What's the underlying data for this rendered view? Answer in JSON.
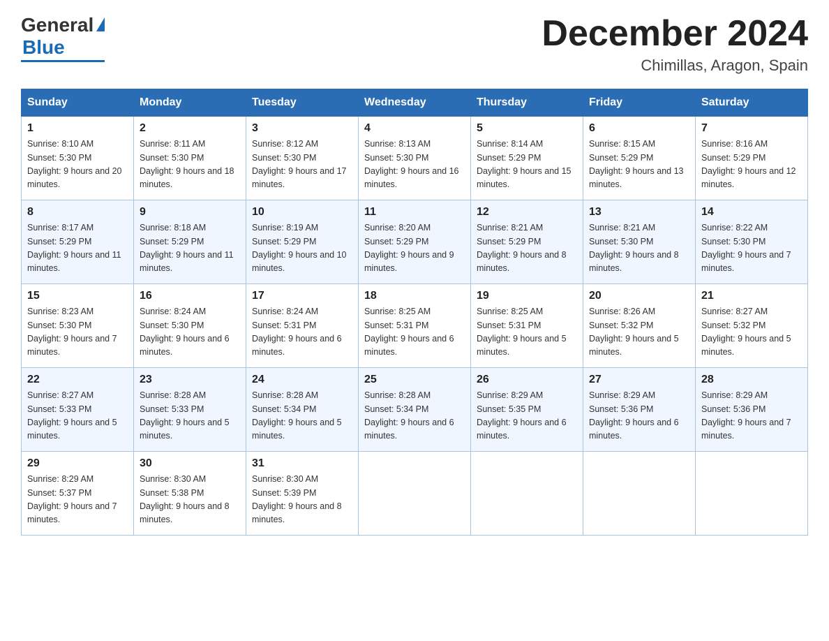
{
  "header": {
    "logo": {
      "general": "General",
      "blue": "Blue"
    },
    "month_title": "December 2024",
    "location": "Chimillas, Aragon, Spain"
  },
  "weekdays": [
    "Sunday",
    "Monday",
    "Tuesday",
    "Wednesday",
    "Thursday",
    "Friday",
    "Saturday"
  ],
  "weeks": [
    [
      {
        "day": "1",
        "sunrise": "8:10 AM",
        "sunset": "5:30 PM",
        "daylight": "9 hours and 20 minutes."
      },
      {
        "day": "2",
        "sunrise": "8:11 AM",
        "sunset": "5:30 PM",
        "daylight": "9 hours and 18 minutes."
      },
      {
        "day": "3",
        "sunrise": "8:12 AM",
        "sunset": "5:30 PM",
        "daylight": "9 hours and 17 minutes."
      },
      {
        "day": "4",
        "sunrise": "8:13 AM",
        "sunset": "5:30 PM",
        "daylight": "9 hours and 16 minutes."
      },
      {
        "day": "5",
        "sunrise": "8:14 AM",
        "sunset": "5:29 PM",
        "daylight": "9 hours and 15 minutes."
      },
      {
        "day": "6",
        "sunrise": "8:15 AM",
        "sunset": "5:29 PM",
        "daylight": "9 hours and 13 minutes."
      },
      {
        "day": "7",
        "sunrise": "8:16 AM",
        "sunset": "5:29 PM",
        "daylight": "9 hours and 12 minutes."
      }
    ],
    [
      {
        "day": "8",
        "sunrise": "8:17 AM",
        "sunset": "5:29 PM",
        "daylight": "9 hours and 11 minutes."
      },
      {
        "day": "9",
        "sunrise": "8:18 AM",
        "sunset": "5:29 PM",
        "daylight": "9 hours and 11 minutes."
      },
      {
        "day": "10",
        "sunrise": "8:19 AM",
        "sunset": "5:29 PM",
        "daylight": "9 hours and 10 minutes."
      },
      {
        "day": "11",
        "sunrise": "8:20 AM",
        "sunset": "5:29 PM",
        "daylight": "9 hours and 9 minutes."
      },
      {
        "day": "12",
        "sunrise": "8:21 AM",
        "sunset": "5:29 PM",
        "daylight": "9 hours and 8 minutes."
      },
      {
        "day": "13",
        "sunrise": "8:21 AM",
        "sunset": "5:30 PM",
        "daylight": "9 hours and 8 minutes."
      },
      {
        "day": "14",
        "sunrise": "8:22 AM",
        "sunset": "5:30 PM",
        "daylight": "9 hours and 7 minutes."
      }
    ],
    [
      {
        "day": "15",
        "sunrise": "8:23 AM",
        "sunset": "5:30 PM",
        "daylight": "9 hours and 7 minutes."
      },
      {
        "day": "16",
        "sunrise": "8:24 AM",
        "sunset": "5:30 PM",
        "daylight": "9 hours and 6 minutes."
      },
      {
        "day": "17",
        "sunrise": "8:24 AM",
        "sunset": "5:31 PM",
        "daylight": "9 hours and 6 minutes."
      },
      {
        "day": "18",
        "sunrise": "8:25 AM",
        "sunset": "5:31 PM",
        "daylight": "9 hours and 6 minutes."
      },
      {
        "day": "19",
        "sunrise": "8:25 AM",
        "sunset": "5:31 PM",
        "daylight": "9 hours and 5 minutes."
      },
      {
        "day": "20",
        "sunrise": "8:26 AM",
        "sunset": "5:32 PM",
        "daylight": "9 hours and 5 minutes."
      },
      {
        "day": "21",
        "sunrise": "8:27 AM",
        "sunset": "5:32 PM",
        "daylight": "9 hours and 5 minutes."
      }
    ],
    [
      {
        "day": "22",
        "sunrise": "8:27 AM",
        "sunset": "5:33 PM",
        "daylight": "9 hours and 5 minutes."
      },
      {
        "day": "23",
        "sunrise": "8:28 AM",
        "sunset": "5:33 PM",
        "daylight": "9 hours and 5 minutes."
      },
      {
        "day": "24",
        "sunrise": "8:28 AM",
        "sunset": "5:34 PM",
        "daylight": "9 hours and 5 minutes."
      },
      {
        "day": "25",
        "sunrise": "8:28 AM",
        "sunset": "5:34 PM",
        "daylight": "9 hours and 6 minutes."
      },
      {
        "day": "26",
        "sunrise": "8:29 AM",
        "sunset": "5:35 PM",
        "daylight": "9 hours and 6 minutes."
      },
      {
        "day": "27",
        "sunrise": "8:29 AM",
        "sunset": "5:36 PM",
        "daylight": "9 hours and 6 minutes."
      },
      {
        "day": "28",
        "sunrise": "8:29 AM",
        "sunset": "5:36 PM",
        "daylight": "9 hours and 7 minutes."
      }
    ],
    [
      {
        "day": "29",
        "sunrise": "8:29 AM",
        "sunset": "5:37 PM",
        "daylight": "9 hours and 7 minutes."
      },
      {
        "day": "30",
        "sunrise": "8:30 AM",
        "sunset": "5:38 PM",
        "daylight": "9 hours and 8 minutes."
      },
      {
        "day": "31",
        "sunrise": "8:30 AM",
        "sunset": "5:39 PM",
        "daylight": "9 hours and 8 minutes."
      },
      null,
      null,
      null,
      null
    ]
  ]
}
